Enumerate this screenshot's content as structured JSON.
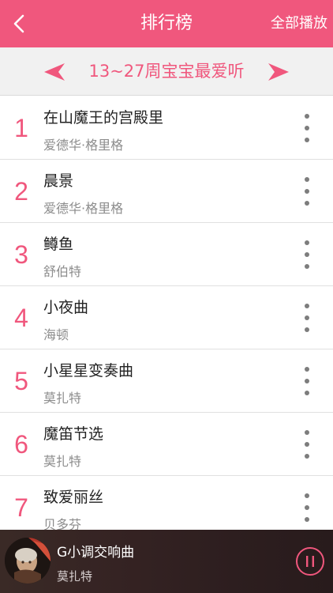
{
  "header": {
    "title": "排行榜",
    "play_all_label": "全部播放"
  },
  "subheader": {
    "title": "13~27周宝宝最爱听"
  },
  "songs": [
    {
      "rank": "1",
      "title": "在山魔王的宫殿里",
      "artist": "爱德华·格里格"
    },
    {
      "rank": "2",
      "title": "晨景",
      "artist": "爱德华·格里格"
    },
    {
      "rank": "3",
      "title": "鳟鱼",
      "artist": "舒伯特"
    },
    {
      "rank": "4",
      "title": "小夜曲",
      "artist": "海顿"
    },
    {
      "rank": "5",
      "title": "小星星变奏曲",
      "artist": "莫扎特"
    },
    {
      "rank": "6",
      "title": "魔笛节选",
      "artist": "莫扎特"
    },
    {
      "rank": "7",
      "title": "致爱丽丝",
      "artist": "贝多芬"
    }
  ],
  "now_playing": {
    "title": "G小调交响曲",
    "artist": "莫扎特"
  },
  "icons": {
    "back": "chevron-left-icon",
    "prev": "triangle-left-icon",
    "next": "triangle-right-icon",
    "more": "more-vertical-icon",
    "pause": "pause-circle-icon"
  },
  "colors": {
    "accent": "#f0577d",
    "subbar_bg": "#f1f1f1",
    "player_bg": "#2e2020"
  }
}
